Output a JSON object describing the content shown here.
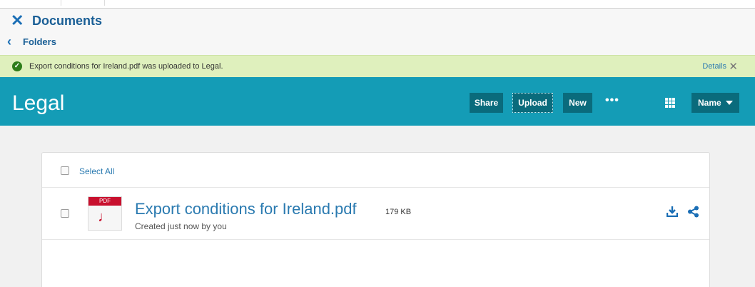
{
  "header": {
    "title": "Documents",
    "back_label": "Folders"
  },
  "notice": {
    "message": "Export conditions for Ireland.pdf was uploaded to Legal.",
    "details_label": "Details"
  },
  "toolbar": {
    "folder_title": "Legal",
    "share_label": "Share",
    "upload_label": "Upload",
    "new_label": "New",
    "more_label": "•••",
    "sort_label": "Name"
  },
  "list": {
    "select_all_label": "Select All",
    "files": [
      {
        "name": "Export conditions for Ireland.pdf",
        "size": "179 KB",
        "meta": "Created just now by you",
        "type_tag": "PDF"
      }
    ]
  },
  "colors": {
    "accent": "#149cb6",
    "button": "#0a6b7c",
    "link": "#2a7ab0",
    "notice_bg": "#dff0bd",
    "pdf_red": "#c8102e"
  },
  "icons": [
    "close-icon",
    "chevron-left-icon",
    "check-circle-icon",
    "dismiss-icon",
    "more-icon",
    "grid-view-icon",
    "caret-down-icon",
    "pdf-file-icon",
    "download-icon",
    "share-icon"
  ]
}
